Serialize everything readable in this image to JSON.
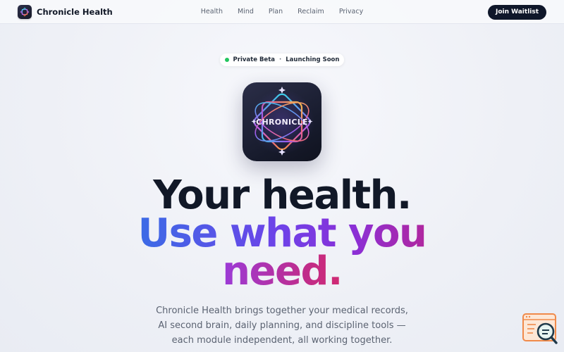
{
  "brand": {
    "name": "Chronicle Health"
  },
  "nav": {
    "items": [
      "Health",
      "Mind",
      "Plan",
      "Reclaim",
      "Privacy"
    ]
  },
  "cta": {
    "label": "Join Waitlist"
  },
  "badge": {
    "left": "Private Beta",
    "separator": "·",
    "right": "Launching Soon"
  },
  "app_icon": {
    "text": "CHRONICLE"
  },
  "hero": {
    "line1": "Your health.",
    "line2": "Use what you",
    "line3": "need."
  },
  "description": {
    "lines": [
      "Chronicle Health brings together your medical records,",
      "AI second brain, daily planning, and discipline tools —",
      "each module independent, all working together."
    ]
  },
  "colors": {
    "accent_blue": "#3b6be6",
    "accent_purple": "#6f42e8",
    "accent_magenta": "#c02c8a",
    "status_green": "#22c55e",
    "cta_bg": "#0f172a"
  },
  "icons": {
    "corner_widget": "search-feedback-icon"
  }
}
